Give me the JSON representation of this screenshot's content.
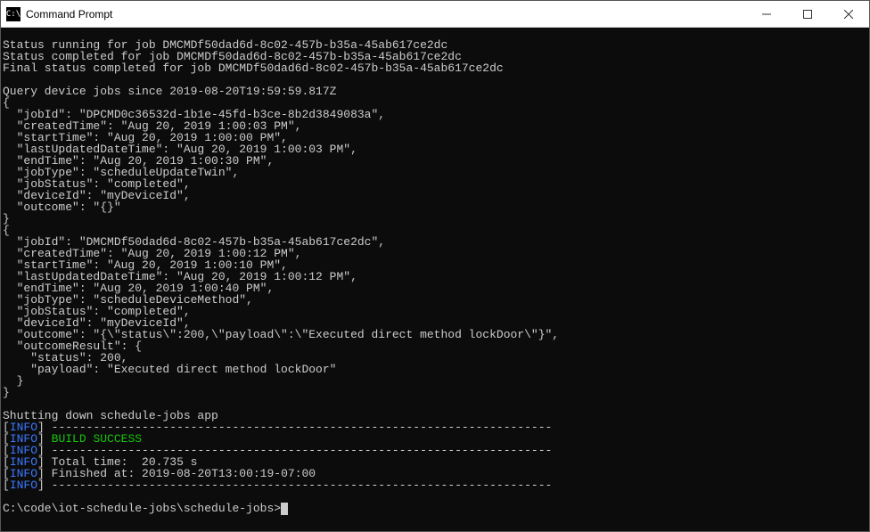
{
  "window": {
    "title": "Command Prompt",
    "icon_text": "C:\\"
  },
  "terminal": {
    "status_lines": [
      "Status running for job DMCMDf50dad6d-8c02-457b-b35a-45ab617ce2dc",
      "Status completed for job DMCMDf50dad6d-8c02-457b-b35a-45ab617ce2dc",
      "Final status completed for job DMCMDf50dad6d-8c02-457b-b35a-45ab617ce2dc"
    ],
    "query_line": "Query device jobs since 2019-08-20T19:59:59.817Z",
    "job1": {
      "open": "{",
      "jobId": "  \"jobId\": \"DPCMD0c36532d-1b1e-45fd-b3ce-8b2d3849083a\",",
      "createdTime": "  \"createdTime\": \"Aug 20, 2019 1:00:03 PM\",",
      "startTime": "  \"startTime\": \"Aug 20, 2019 1:00:00 PM\",",
      "lastUpdated": "  \"lastUpdatedDateTime\": \"Aug 20, 2019 1:00:03 PM\",",
      "endTime": "  \"endTime\": \"Aug 20, 2019 1:00:30 PM\",",
      "jobType": "  \"jobType\": \"scheduleUpdateTwin\",",
      "jobStatus": "  \"jobStatus\": \"completed\",",
      "deviceId": "  \"deviceId\": \"myDeviceId\",",
      "outcome": "  \"outcome\": \"{}\"",
      "close": "}"
    },
    "job2": {
      "open": "{",
      "jobId": "  \"jobId\": \"DMCMDf50dad6d-8c02-457b-b35a-45ab617ce2dc\",",
      "createdTime": "  \"createdTime\": \"Aug 20, 2019 1:00:12 PM\",",
      "startTime": "  \"startTime\": \"Aug 20, 2019 1:00:10 PM\",",
      "lastUpdated": "  \"lastUpdatedDateTime\": \"Aug 20, 2019 1:00:12 PM\",",
      "endTime": "  \"endTime\": \"Aug 20, 2019 1:00:40 PM\",",
      "jobType": "  \"jobType\": \"scheduleDeviceMethod\",",
      "jobStatus": "  \"jobStatus\": \"completed\",",
      "deviceId": "  \"deviceId\": \"myDeviceId\",",
      "outcome": "  \"outcome\": \"{\\\"status\\\":200,\\\"payload\\\":\\\"Executed direct method lockDoor\\\"}\",",
      "outcomeResult": "  \"outcomeResult\": {",
      "status": "    \"status\": 200,",
      "payload": "    \"payload\": \"Executed direct method lockDoor\"",
      "closeInner": "  }",
      "close": "}"
    },
    "shutdown": "Shutting down schedule-jobs app",
    "info_label": "INFO",
    "dashes": " ------------------------------------------------------------------------",
    "build_success": " BUILD SUCCESS",
    "total_time": " Total time:  20.735 s",
    "finished_at": " Finished at: 2019-08-20T13:00:19-07:00",
    "prompt": "C:\\code\\iot-schedule-jobs\\schedule-jobs>"
  }
}
